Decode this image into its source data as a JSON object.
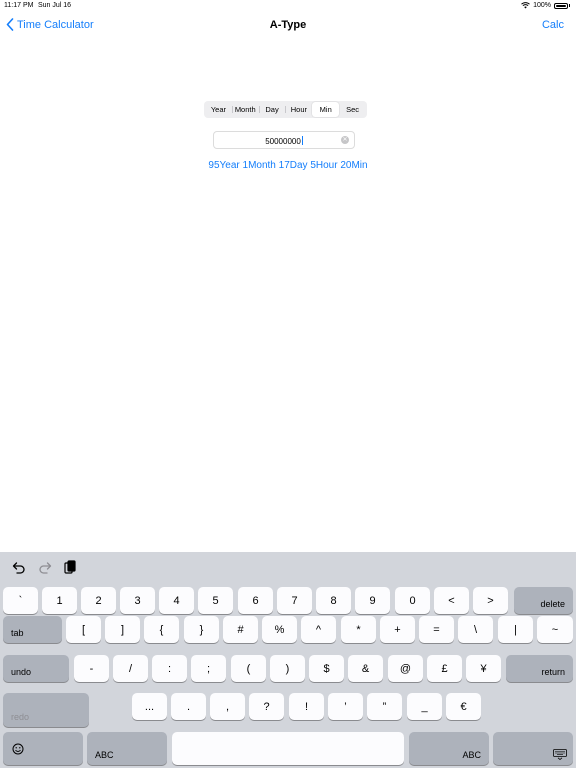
{
  "status_bar": {
    "time": "11:17 PM",
    "date": "Sun Jul 16",
    "battery": "100%"
  },
  "nav": {
    "back_label": "Time Calculator",
    "title": "A-Type",
    "right_label": "Calc"
  },
  "segments": [
    "Year",
    "Month",
    "Day",
    "Hour",
    "Min",
    "Sec"
  ],
  "selected_segment": "Min",
  "input": {
    "value": "50000000"
  },
  "result": "95Year 1Month 17Day 5Hour 20Min",
  "keyboard": {
    "row1": [
      "`",
      "1",
      "2",
      "3",
      "4",
      "5",
      "6",
      "7",
      "8",
      "9",
      "0",
      "<",
      ">"
    ],
    "delete_label": "delete",
    "tab_label": "tab",
    "row2": [
      "[",
      "]",
      "{",
      "}",
      "#",
      "%",
      "^",
      "*",
      "+",
      "=",
      "\\",
      "|",
      "~"
    ],
    "undo_label": "undo",
    "row3": [
      "-",
      "/",
      ":",
      ";",
      "(",
      ")",
      "$",
      "&",
      "@",
      "£",
      "¥"
    ],
    "return_label": "return",
    "redo_label": "redo",
    "row4": [
      "...",
      ".",
      ",",
      "?",
      "!",
      "’",
      "”",
      "_",
      "€"
    ],
    "abc_label": "ABC",
    "abc_right_label": "ABC"
  },
  "colors": {
    "accent": "#147efb",
    "keyboard_bg": "#d2d5db"
  }
}
